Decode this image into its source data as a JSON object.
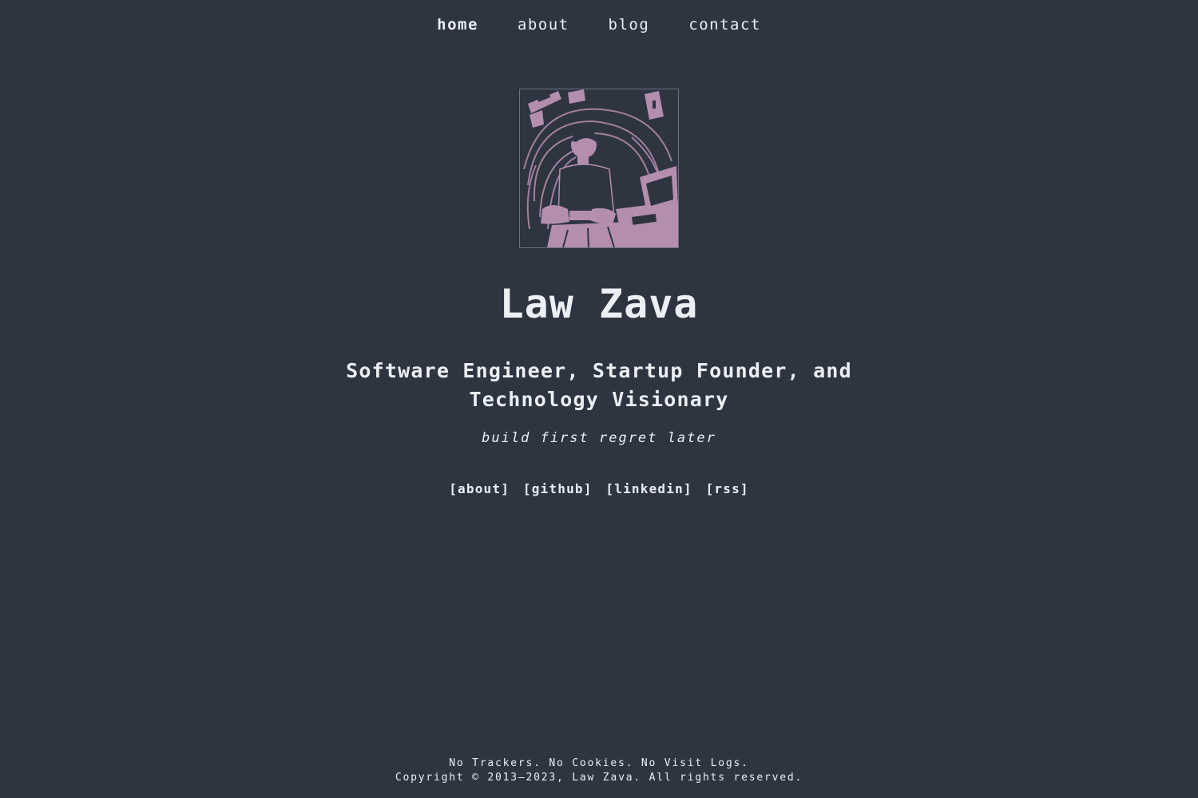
{
  "nav": {
    "items": [
      {
        "label": "home",
        "active": true
      },
      {
        "label": "about",
        "active": false
      },
      {
        "label": "blog",
        "active": false
      },
      {
        "label": "contact",
        "active": false
      }
    ]
  },
  "profile": {
    "name": "Law Zava",
    "title": "Software Engineer, Startup Founder, and Technology Visionary",
    "tagline": "build first regret later",
    "avatar_icon": "person-at-laptop-illustration"
  },
  "links": [
    {
      "label": "[about]"
    },
    {
      "label": "[github]"
    },
    {
      "label": "[linkedin]"
    },
    {
      "label": "[rss]"
    }
  ],
  "footer": {
    "line1": "No Trackers. No Cookies. No Visit Logs.",
    "line2": "Copyright © 2013–2023, Law Zava. All rights reserved."
  },
  "colors": {
    "background": "#2e3440",
    "text": "#eceff4",
    "accent": "#b48ead"
  }
}
